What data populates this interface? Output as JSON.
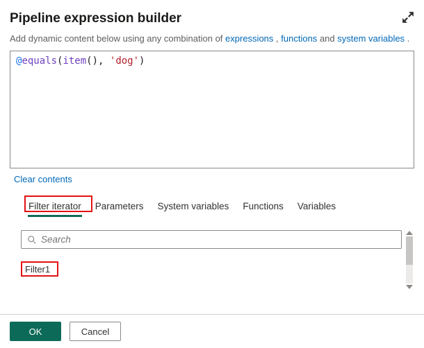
{
  "header": {
    "title": "Pipeline expression builder"
  },
  "help": {
    "prefix": "Add dynamic content below using any combination of ",
    "link_expressions": "expressions",
    "sep1": ", ",
    "link_functions": "functions",
    "sep2": " and ",
    "link_system_variables": "system variables",
    "suffix": "."
  },
  "editor": {
    "at": "@",
    "fn1": "equals",
    "p1": "(",
    "fn2": "item",
    "p2": "(), ",
    "str": "'dog'",
    "p3": ")"
  },
  "links": {
    "clear": "Clear contents"
  },
  "tabs": {
    "filter_iterator": "Filter iterator",
    "parameters": "Parameters",
    "system_variables": "System variables",
    "functions": "Functions",
    "variables": "Variables"
  },
  "search": {
    "placeholder": "Search"
  },
  "results": {
    "item1": "Filter1"
  },
  "footer": {
    "ok": "OK",
    "cancel": "Cancel"
  }
}
